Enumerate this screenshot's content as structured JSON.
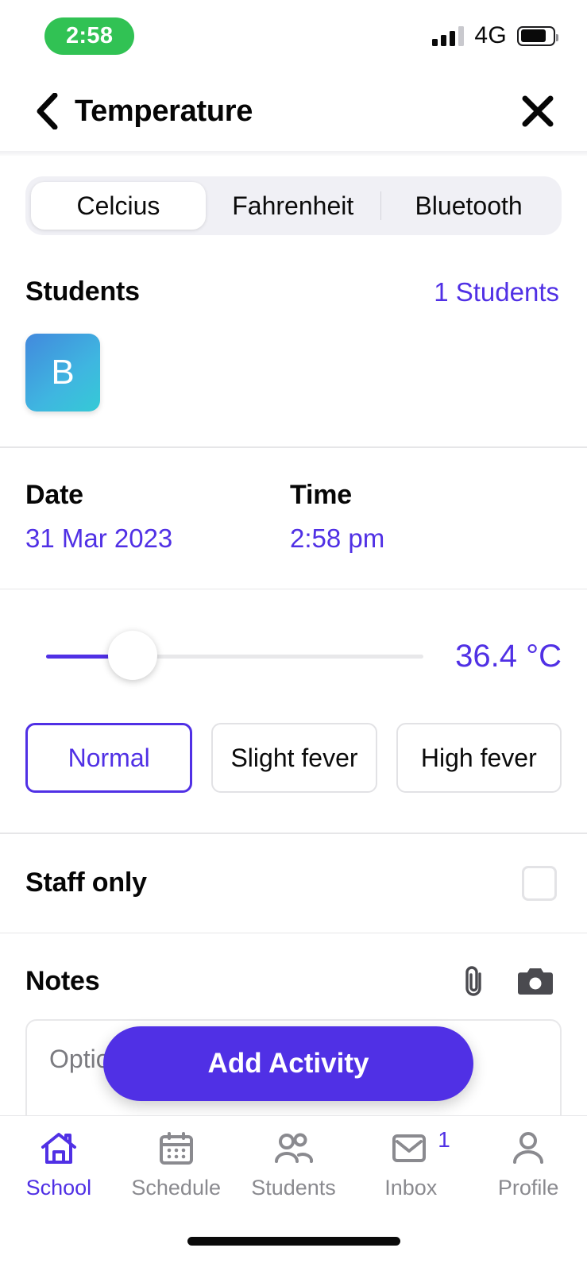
{
  "status_bar": {
    "time": "2:58",
    "network": "4G",
    "time_pill_color": "#31c254"
  },
  "header": {
    "title": "Temperature",
    "back_icon": "chevron-left-icon",
    "close_icon": "close-icon"
  },
  "segmented_control": {
    "options": [
      {
        "label": "Celcius",
        "selected": true
      },
      {
        "label": "Fahrenheit",
        "selected": false
      },
      {
        "label": "Bluetooth",
        "selected": false
      }
    ]
  },
  "students": {
    "label": "Students",
    "count_label": "1 Students",
    "avatars": [
      {
        "initial": "B"
      }
    ]
  },
  "date_time": {
    "date_label": "Date",
    "date_value": "31 Mar 2023",
    "time_label": "Time",
    "time_value": "2:58 pm"
  },
  "temperature": {
    "value_label": "36.4 °C",
    "slider_percent": 23
  },
  "severity": {
    "options": [
      {
        "label": "Normal",
        "selected": true
      },
      {
        "label": "Slight fever",
        "selected": false
      },
      {
        "label": "High fever",
        "selected": false
      }
    ]
  },
  "staff_only": {
    "label": "Staff only",
    "checked": false
  },
  "notes": {
    "label": "Notes",
    "placeholder": "Optional",
    "attach_icon": "paperclip-icon",
    "camera_icon": "camera-icon"
  },
  "cta": {
    "label": "Add Activity"
  },
  "tabbar": {
    "tabs": [
      {
        "label": "School",
        "icon": "home-icon",
        "active": true,
        "badge": ""
      },
      {
        "label": "Schedule",
        "icon": "calendar-icon",
        "active": false,
        "badge": ""
      },
      {
        "label": "Students",
        "icon": "people-icon",
        "active": false,
        "badge": ""
      },
      {
        "label": "Inbox",
        "icon": "envelope-icon",
        "active": false,
        "badge": "1"
      },
      {
        "label": "Profile",
        "icon": "person-icon",
        "active": false,
        "badge": ""
      }
    ]
  },
  "colors": {
    "accent_purple": "#5030e5",
    "status_green": "#31c254",
    "avatar_gradient_start": "#4289dd",
    "avatar_gradient_end": "#35cad6"
  }
}
